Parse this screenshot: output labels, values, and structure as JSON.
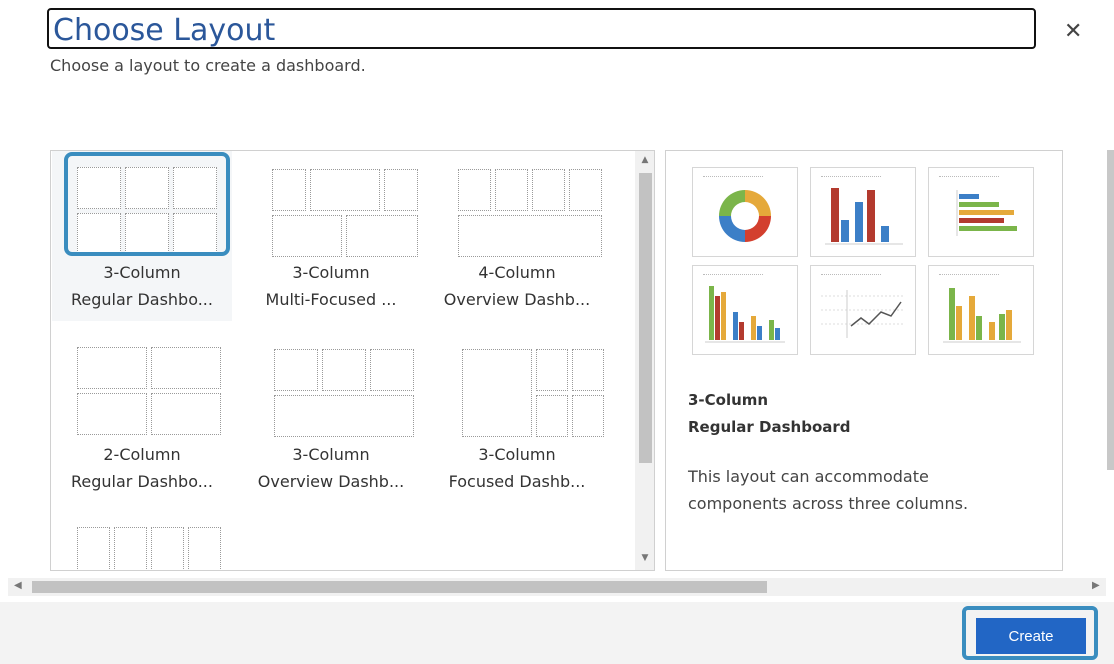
{
  "dialog": {
    "title": "Choose Layout",
    "subtitle": "Choose a layout to create a dashboard.",
    "close_icon": "close-icon"
  },
  "layouts": [
    {
      "label_line1": "3-Column",
      "label_line2": "Regular Dashbo...",
      "selected": true
    },
    {
      "label_line1": "3-Column",
      "label_line2": "Multi-Focused ...",
      "selected": false
    },
    {
      "label_line1": "4-Column",
      "label_line2": "Overview Dashb...",
      "selected": false
    },
    {
      "label_line1": "2-Column",
      "label_line2": "Regular Dashbo...",
      "selected": false
    },
    {
      "label_line1": "3-Column",
      "label_line2": "Overview Dashb...",
      "selected": false
    },
    {
      "label_line1": "3-Column",
      "label_line2": "Focused Dashb...",
      "selected": false
    }
  ],
  "preview": {
    "name_line1": "3-Column",
    "name_line2": "Regular Dashboard",
    "description": "This layout can accommodate components across three columns."
  },
  "footer": {
    "create_label": "Create"
  },
  "colors": {
    "accent": "#2266c5",
    "title": "#2b579a",
    "selection": "#3a8dbf"
  }
}
